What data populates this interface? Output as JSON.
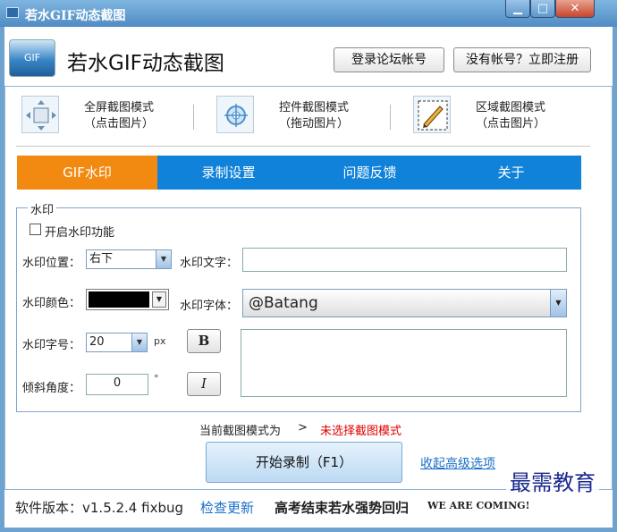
{
  "window": {
    "title": "若水GIF动态截图",
    "buttons": {
      "minimize": "▁",
      "maximize": "□",
      "close": "✕"
    }
  },
  "header": {
    "logo_text": "GIF",
    "app_title": "若水GIF动态截图",
    "login_label": "登录论坛帐号",
    "register_label": "没有帐号？立即注册"
  },
  "modes": [
    {
      "line1": "全屏截图模式",
      "line2": "（点击图片）",
      "icon": "fullscreen-icon"
    },
    {
      "line1": "控件截图模式",
      "line2": "（拖动图片）",
      "icon": "crosshair-icon"
    },
    {
      "line1": "区域截图模式",
      "line2": "（点击图片）",
      "icon": "pen-icon"
    }
  ],
  "tabs": [
    {
      "label": "GIF水印",
      "active": true
    },
    {
      "label": "录制设置",
      "active": false
    },
    {
      "label": "问题反馈",
      "active": false
    },
    {
      "label": "关于",
      "active": false
    }
  ],
  "watermark_group": {
    "legend": "水印",
    "enable_label": "开启水印功能",
    "enable_checked": false,
    "position_label": "水印位置：",
    "position_value": "右下",
    "text_label": "水印文字：",
    "text_value": "",
    "color_label": "水印颜色：",
    "color_value": "#000000",
    "font_label": "水印字体：",
    "font_value": "@Batang",
    "size_label": "水印字号：",
    "size_value": "20",
    "size_unit": "px",
    "bold_label": "B",
    "angle_label": "倾斜角度：",
    "angle_value": "0",
    "angle_unit": "°",
    "italic_label": "I"
  },
  "status": {
    "label": "当前截图模式为",
    "arrow": ">",
    "value": "未选择截图模式",
    "value_color": "#e00000"
  },
  "actions": {
    "start_label": "开始录制（F1）",
    "collapse_label": "收起高级选项"
  },
  "footer": {
    "version": "软件版本：v1.5.2.4 fixbug",
    "update_link": "检查更新",
    "slogan": "高考结束若水强势回归",
    "motto": "WE ARE COMING!"
  },
  "watermark_overlay": "最需教育"
}
